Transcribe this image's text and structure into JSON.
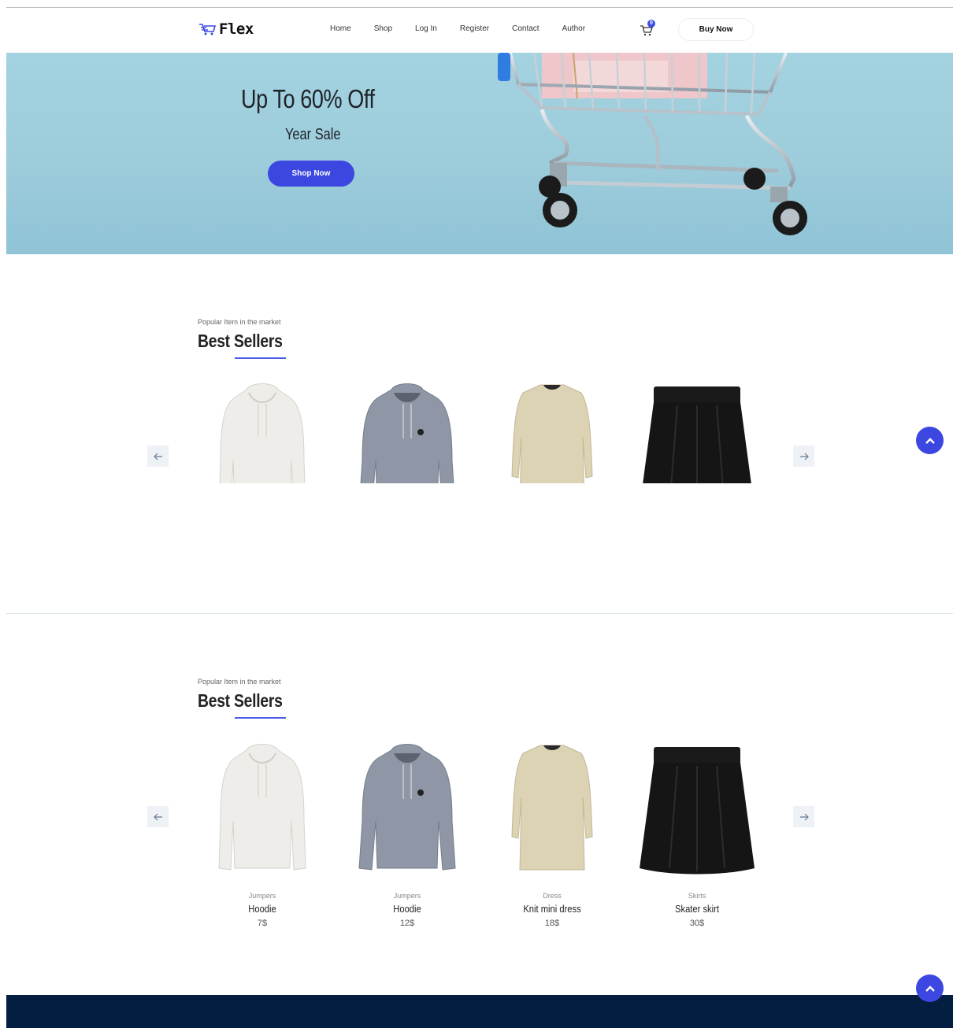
{
  "header": {
    "logo_text": "Flex",
    "nav": [
      "Home",
      "Shop",
      "Log In",
      "Register",
      "Contact",
      "Author"
    ],
    "cart_count": "0",
    "buy_label": "Buy Now"
  },
  "hero": {
    "title": "Up To 60% Off",
    "subtitle": "Year Sale",
    "cta": "Shop Now"
  },
  "sections": [
    {
      "eyebrow": "Popular Item in the market",
      "title": "Best Sellers"
    },
    {
      "eyebrow": "Popular Item in the market",
      "title": "Best Sellers"
    }
  ],
  "products": [
    {
      "category": "Jumpers",
      "name": "Hoodie",
      "price": "7$",
      "color": "#eeede9"
    },
    {
      "category": "Jumpers",
      "name": "Hoodie",
      "price": "12$",
      "color": "#8f96a6"
    },
    {
      "category": "Dress",
      "name": "Knit mini dress",
      "price": "18$",
      "color": "#dcd2b4"
    },
    {
      "category": "Skirts",
      "name": "Skater skirt",
      "price": "30$",
      "color": "#151515"
    }
  ],
  "colors": {
    "accent": "#3b47e0",
    "footer": "#041e42",
    "hero_bg": "#a3d2e0"
  }
}
